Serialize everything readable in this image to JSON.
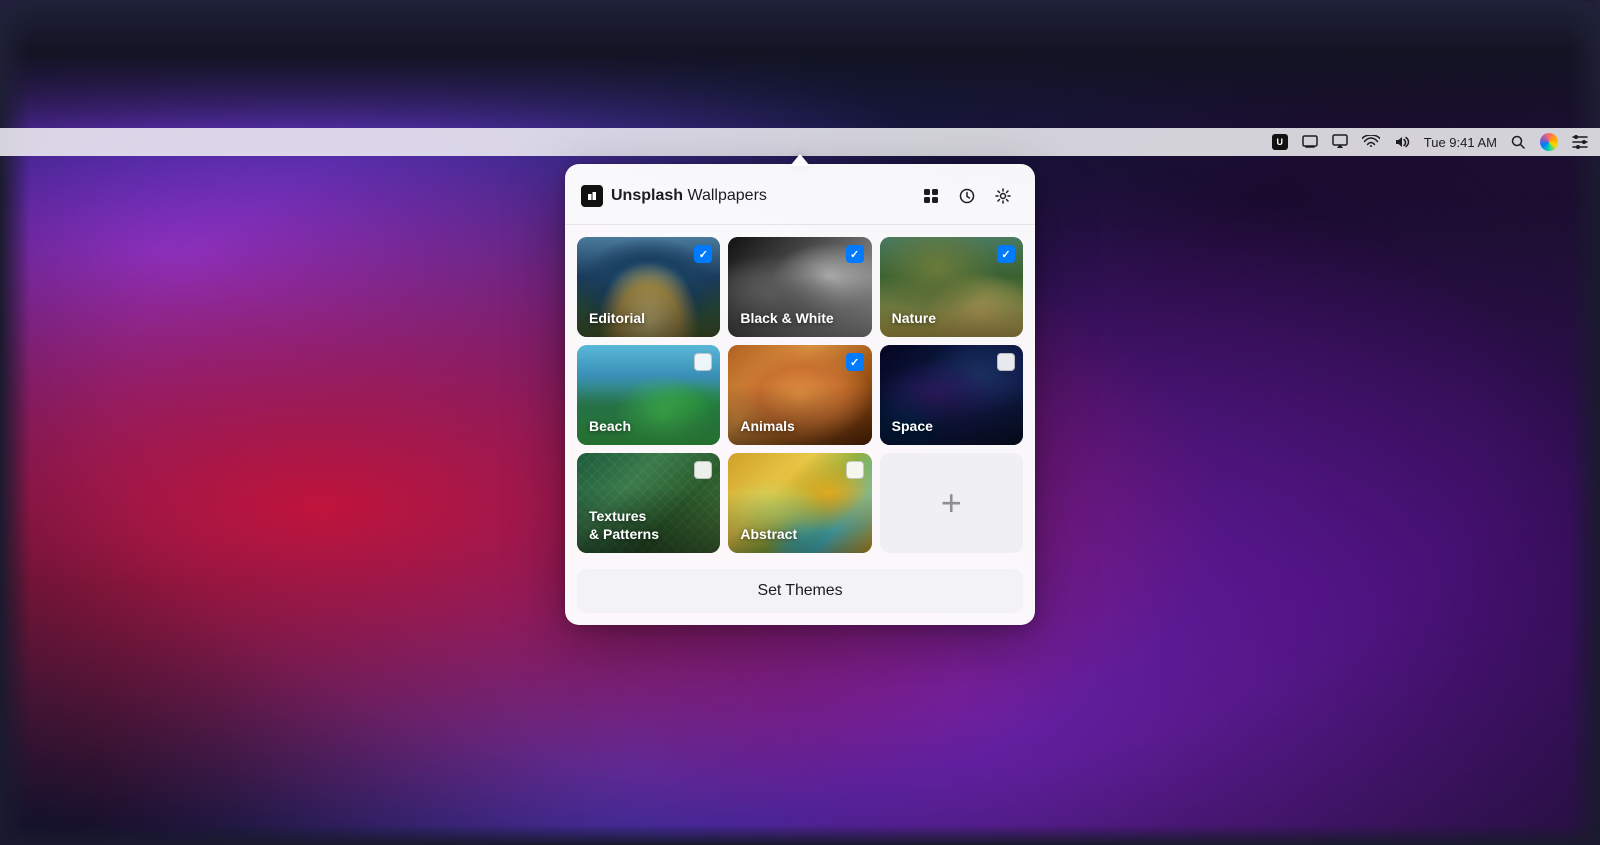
{
  "desktop": {
    "bg_description": "macOS colorful abstract wallpaper"
  },
  "menubar": {
    "time": "Tue 9:41 AM",
    "items": [
      {
        "name": "screen-mirror-icon",
        "symbol": "⊡"
      },
      {
        "name": "wifi-icon",
        "symbol": "⌼"
      },
      {
        "name": "volume-icon",
        "symbol": "◁◁"
      },
      {
        "name": "search-icon",
        "symbol": "⌕"
      },
      {
        "name": "siri-icon",
        "symbol": "●"
      },
      {
        "name": "menu-icon",
        "symbol": "≡"
      }
    ]
  },
  "popup": {
    "app_name_regular": "Unsplash",
    "app_name_bold": " Wallpapers",
    "header_buttons": {
      "grid": "⊞",
      "history": "⟳",
      "settings": "⚙"
    },
    "grid_items": [
      {
        "id": "editorial",
        "label": "Editorial",
        "checked": true,
        "bg_class": "bg-editorial"
      },
      {
        "id": "black-white",
        "label": "Black & White",
        "checked": true,
        "bg_class": "bg-blackwhite"
      },
      {
        "id": "nature",
        "label": "Nature",
        "checked": true,
        "bg_class": "bg-nature"
      },
      {
        "id": "beach",
        "label": "Beach",
        "checked": false,
        "bg_class": "bg-beach"
      },
      {
        "id": "animals",
        "label": "Animals",
        "checked": true,
        "bg_class": "bg-animals"
      },
      {
        "id": "space",
        "label": "Space",
        "checked": false,
        "bg_class": "bg-space"
      },
      {
        "id": "textures-patterns",
        "label": "Textures\n& Patterns",
        "label_line1": "Textures",
        "label_line2": "& Patterns",
        "checked": false,
        "bg_class": "bg-textures"
      },
      {
        "id": "abstract",
        "label": "Abstract",
        "checked": false,
        "bg_class": "bg-abstract"
      },
      {
        "id": "add",
        "label": "",
        "checked": null,
        "bg_class": "bg-add"
      }
    ],
    "set_themes_label": "Set Themes"
  }
}
